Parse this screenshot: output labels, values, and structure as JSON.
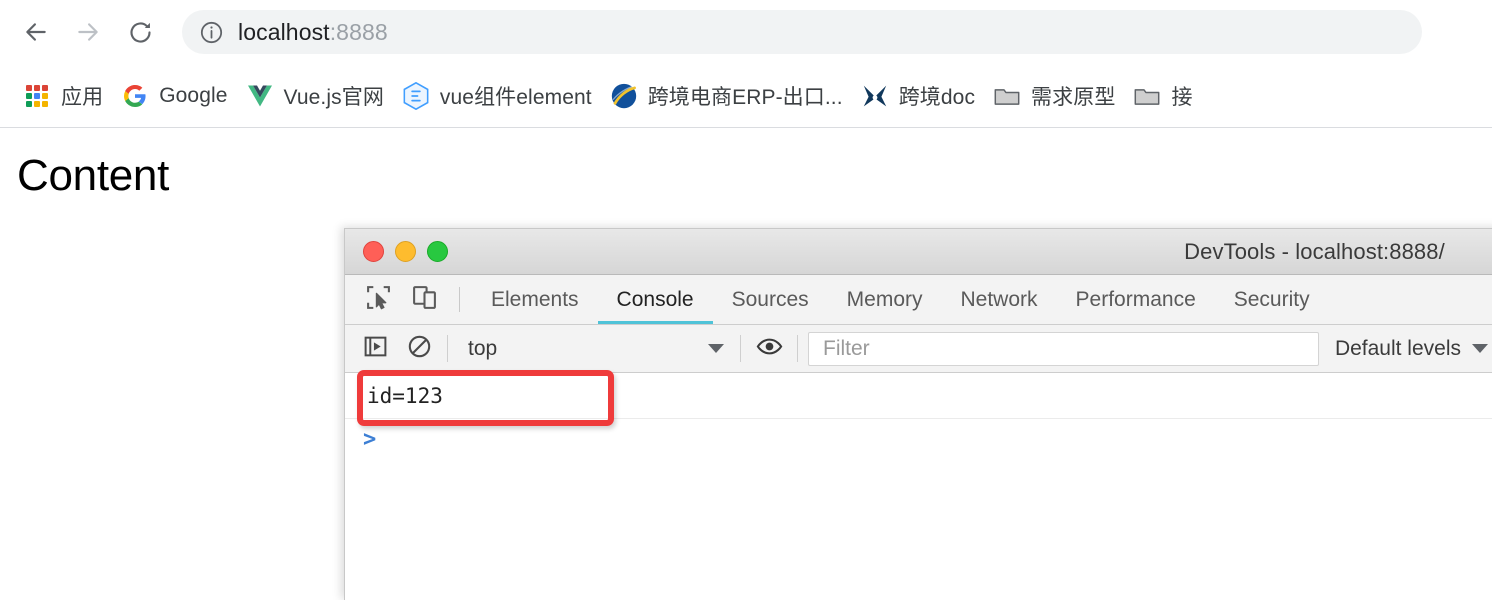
{
  "browser": {
    "nav": {
      "back_icon": "arrow-left-icon",
      "forward_icon": "arrow-right-icon",
      "reload_icon": "reload-icon"
    },
    "omnibox": {
      "security_icon": "info-circle-icon",
      "url_main": "localhost",
      "url_port": ":8888",
      "full_url": "localhost:8888"
    },
    "bookmarks": [
      {
        "label": "应用",
        "icon": "apps-grid-icon"
      },
      {
        "label": "Google",
        "icon": "google-logo-icon"
      },
      {
        "label": "Vue.js官网",
        "icon": "vue-logo-icon"
      },
      {
        "label": "vue组件element",
        "icon": "element-logo-icon"
      },
      {
        "label": "跨境电商ERP-出口...",
        "icon": "globe-icon"
      },
      {
        "label": "跨境doc",
        "icon": "x-logo-icon"
      },
      {
        "label": "需求原型",
        "icon": "folder-icon"
      },
      {
        "label": "接",
        "icon": "folder-icon"
      }
    ]
  },
  "page": {
    "heading": "Content"
  },
  "devtools": {
    "window_title": "DevTools - localhost:8888/",
    "traffic_lights": {
      "close": "close-window-button",
      "minimize": "minimize-window-button",
      "maximize": "maximize-window-button"
    },
    "tools": {
      "inspect_icon": "inspect-element-icon",
      "device_icon": "device-toolbar-icon"
    },
    "tabs": [
      {
        "label": "Elements",
        "active": false
      },
      {
        "label": "Console",
        "active": true
      },
      {
        "label": "Sources",
        "active": false
      },
      {
        "label": "Memory",
        "active": false
      },
      {
        "label": "Network",
        "active": false
      },
      {
        "label": "Performance",
        "active": false
      },
      {
        "label": "Security",
        "active": false
      }
    ],
    "active_tab_color": "#4fc3d8",
    "console_toolbar": {
      "sidebar_icon": "console-sidebar-toggle-icon",
      "clear_icon": "clear-console-icon",
      "context_value": "top",
      "eye_icon": "live-expression-eye-icon",
      "filter_placeholder": "Filter",
      "filter_value": "",
      "levels_value": "Default levels"
    },
    "console_output": [
      {
        "text": "id=123"
      }
    ],
    "prompt_symbol": ">",
    "annotation": {
      "type": "rectangle-highlight",
      "color": "#ef3b3b",
      "target": "id=123"
    }
  }
}
